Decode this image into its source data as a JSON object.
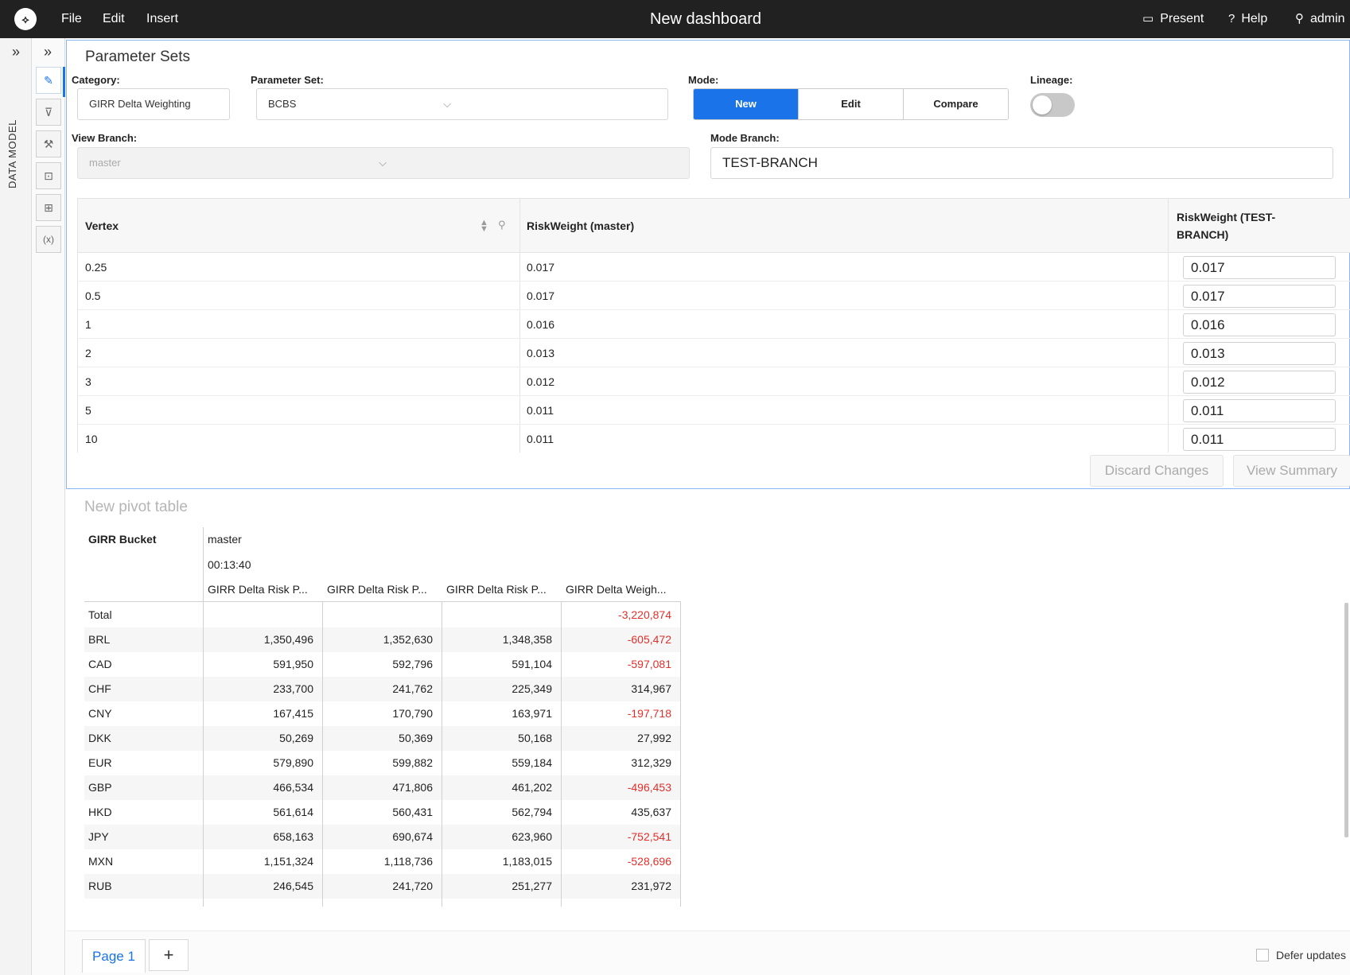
{
  "topbar": {
    "logo_glyph": "⟡",
    "menu": [
      "File",
      "Edit",
      "Insert"
    ],
    "title": "New dashboard",
    "present": "Present",
    "help": "Help",
    "user": "admin"
  },
  "sidebar": {
    "label": "DATA MODEL",
    "tools": [
      "pencil-icon",
      "filter-icon",
      "paint-roller-icon",
      "terminal-icon",
      "sliders-icon",
      "variable-icon"
    ],
    "tool_glyphs": [
      "✎",
      "⊽",
      "⚒",
      "⊡",
      "⊞",
      "(x)"
    ]
  },
  "parameter_sets": {
    "title": "Parameter Sets",
    "category_label": "Category:",
    "category_value": "GIRR Delta Weighting",
    "parameter_set_label": "Parameter Set:",
    "parameter_set_value": "BCBS",
    "mode_label": "Mode:",
    "modes": [
      "New",
      "Edit",
      "Compare"
    ],
    "active_mode": "New",
    "lineage_label": "Lineage:",
    "lineage_on": false,
    "view_branch_label": "View Branch:",
    "view_branch_value": "master",
    "mode_branch_label": "Mode Branch:",
    "mode_branch_value": "TEST-BRANCH",
    "grid": {
      "columns": [
        "Vertex",
        "RiskWeight (master)",
        "RiskWeight (TEST-BRANCH)"
      ],
      "rows": [
        [
          "0.25",
          "0.017",
          "0.017"
        ],
        [
          "0.5",
          "0.017",
          "0.017"
        ],
        [
          "1",
          "0.016",
          "0.016"
        ],
        [
          "2",
          "0.013",
          "0.013"
        ],
        [
          "3",
          "0.012",
          "0.012"
        ],
        [
          "5",
          "0.011",
          "0.011"
        ],
        [
          "10",
          "0.011",
          "0.011"
        ]
      ]
    },
    "discard_label": "Discard Changes",
    "summary_label": "View Summary"
  },
  "pivot": {
    "title": "New pivot table",
    "row_header": "GIRR Bucket",
    "branch": "master",
    "time": "00:13:40",
    "columns": [
      "GIRR Delta Risk P...",
      "GIRR Delta Risk P...",
      "GIRR Delta Risk P...",
      "GIRR Delta Weigh..."
    ],
    "rows": [
      [
        "Total",
        "",
        "",
        "",
        "-3,220,874"
      ],
      [
        "BRL",
        "1,350,496",
        "1,352,630",
        "1,348,358",
        "-605,472"
      ],
      [
        "CAD",
        "591,950",
        "592,796",
        "591,104",
        "-597,081"
      ],
      [
        "CHF",
        "233,700",
        "241,762",
        "225,349",
        "314,967"
      ],
      [
        "CNY",
        "167,415",
        "170,790",
        "163,971",
        "-197,718"
      ],
      [
        "DKK",
        "50,269",
        "50,369",
        "50,168",
        "27,992"
      ],
      [
        "EUR",
        "579,890",
        "599,882",
        "559,184",
        "312,329"
      ],
      [
        "GBP",
        "466,534",
        "471,806",
        "461,202",
        "-496,453"
      ],
      [
        "HKD",
        "561,614",
        "560,431",
        "562,794",
        "435,637"
      ],
      [
        "JPY",
        "658,163",
        "690,674",
        "623,960",
        "-752,541"
      ],
      [
        "MXN",
        "1,151,324",
        "1,118,736",
        "1,183,015",
        "-528,696"
      ],
      [
        "RUB",
        "246,545",
        "241,720",
        "251,277",
        "231,972"
      ]
    ]
  },
  "footer": {
    "page_tab": "Page 1",
    "add_glyph": "+",
    "defer_label": "Defer updates"
  },
  "colors": {
    "accent": "#1a73e8",
    "negative": "#e0302b",
    "topbar": "#212121"
  }
}
